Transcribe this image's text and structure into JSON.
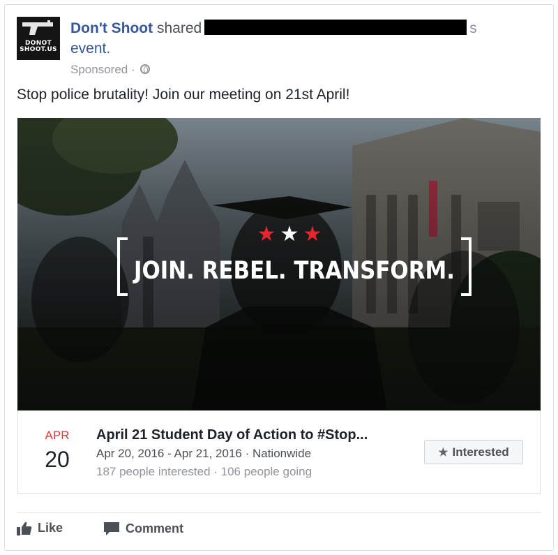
{
  "header": {
    "page_name": "Don't Shoot",
    "shared_text": "shared",
    "tail_text": "s",
    "line2": "event.",
    "sponsored": "Sponsored ·"
  },
  "avatar": {
    "line1": "DONOT",
    "line2": "SHOOT.US"
  },
  "post": {
    "text": "Stop police brutality! Join our meeting on 21st April!"
  },
  "banner": {
    "headline": "JOIN. REBEL. TRANSFORM.",
    "stars": [
      "★",
      "★",
      "★"
    ],
    "star_colors": [
      "#e8242c",
      "#ffffff",
      "#e8242c"
    ]
  },
  "event": {
    "month": "APR",
    "day": "20",
    "title": "April 21 Student Day of Action to #Stop...",
    "dates": "Apr 20, 2016 - Apr 21, 2016 · Nationwide",
    "stats": "187 people interested · 106 people going",
    "interested_label": "Interested"
  },
  "actions": {
    "like": "Like",
    "comment": "Comment"
  },
  "colors": {
    "link": "#365899",
    "accent_red": "#e0393e"
  }
}
